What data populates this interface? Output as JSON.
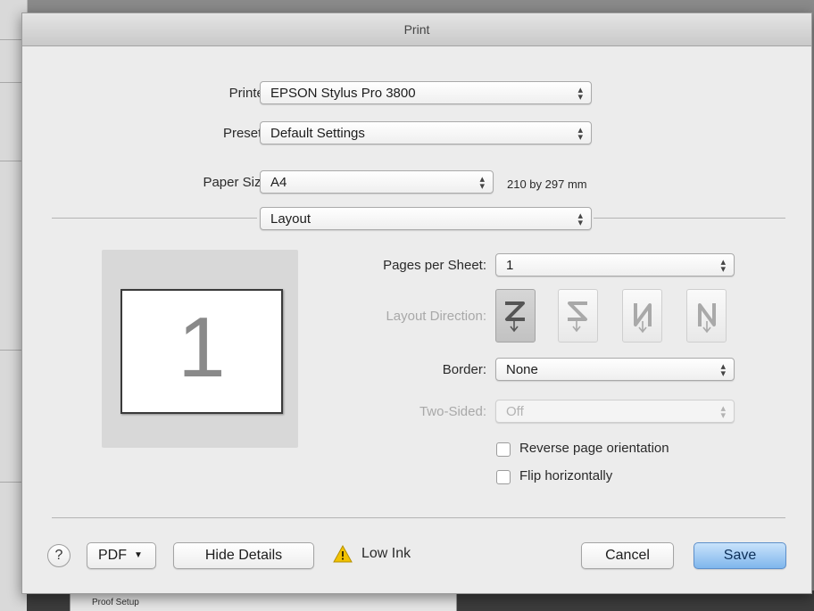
{
  "dialog": {
    "title": "Print"
  },
  "printer": {
    "label": "Printer:",
    "value": "EPSON Stylus Pro 3800"
  },
  "presets": {
    "label": "Presets:",
    "value": "Default Settings"
  },
  "paper_size": {
    "label": "Paper Size:",
    "value": "A4",
    "dimensions": "210 by 297 mm"
  },
  "section": {
    "value": "Layout"
  },
  "preview": {
    "page_number": "1"
  },
  "pages_per_sheet": {
    "label": "Pages per Sheet:",
    "value": "1"
  },
  "layout_direction": {
    "label": "Layout Direction:",
    "options": [
      "z-order-icon",
      "s-order-icon",
      "reverse-n-order-icon",
      "n-order-icon"
    ],
    "selected": 0
  },
  "border": {
    "label": "Border:",
    "value": "None"
  },
  "two_sided": {
    "label": "Two-Sided:",
    "value": "Off"
  },
  "checkboxes": {
    "reverse_orientation": {
      "label": "Reverse page orientation",
      "checked": false
    },
    "flip_horizontally": {
      "label": "Flip horizontally",
      "checked": false
    }
  },
  "footer": {
    "help_label": "?",
    "pdf_label": "PDF",
    "hide_details_label": "Hide Details",
    "low_ink_label": "Low Ink",
    "cancel_label": "Cancel",
    "save_label": "Save"
  },
  "background": {
    "panel_label": "Proof Setup"
  },
  "colors": {
    "accent": "#7fb6ec",
    "warning": "#f2c200"
  }
}
